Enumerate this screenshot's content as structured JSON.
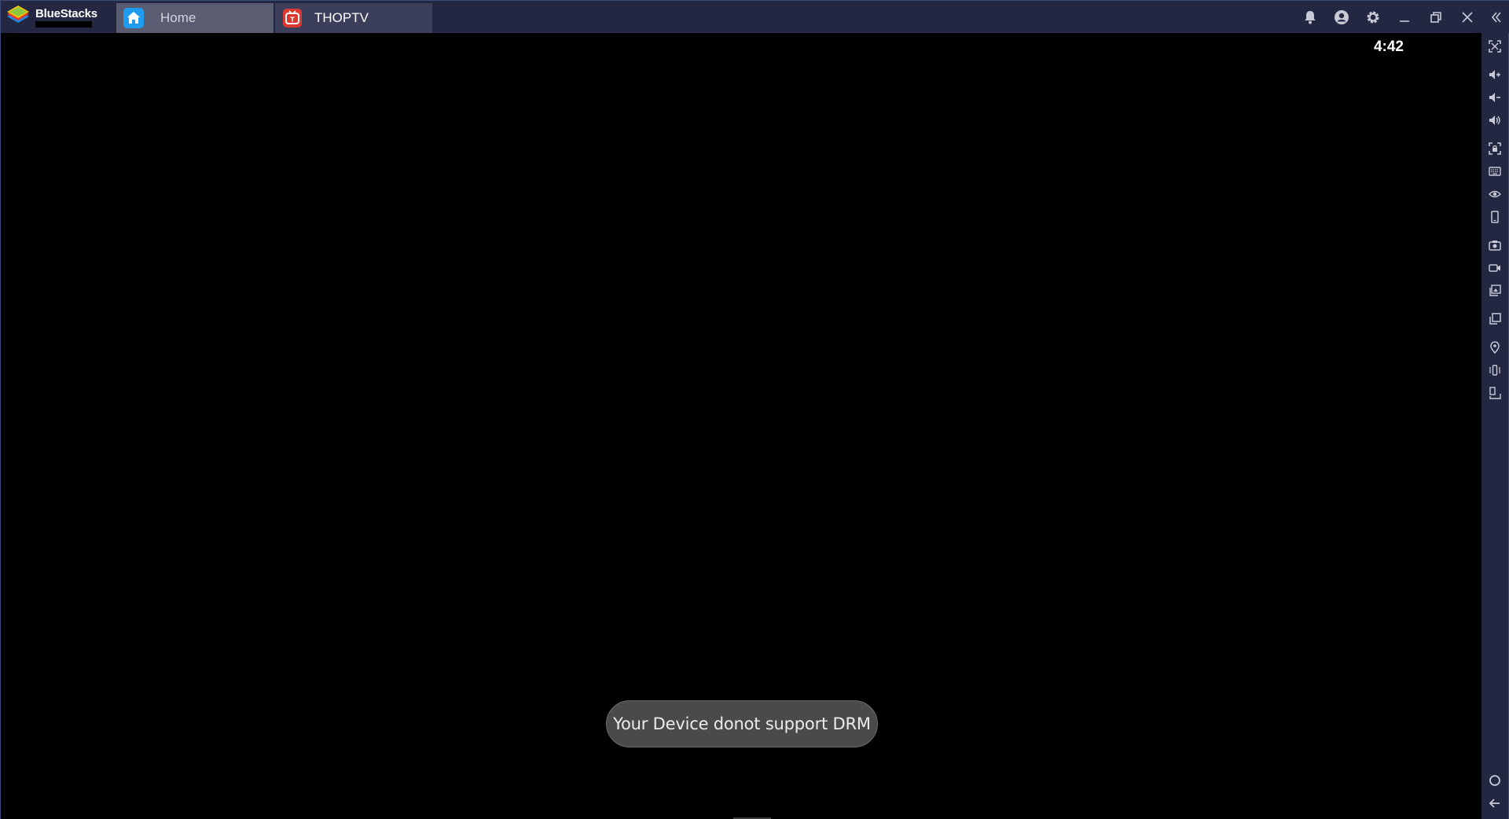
{
  "app": {
    "name": "BlueStacks",
    "brand_colors": {
      "green": "#8dc63f",
      "yellow": "#f7c600",
      "red": "#e03b2e",
      "blue": "#1e88e5"
    }
  },
  "tabs": [
    {
      "label": "Home",
      "icon": "home-icon",
      "active": false
    },
    {
      "label": "THOPTV",
      "icon": "thoptv-app-icon",
      "active": true
    }
  ],
  "window_controls": [
    "bell-icon",
    "account-icon",
    "gear-icon",
    "minimize-icon",
    "restore-icon",
    "close-icon",
    "collapse-sidebar-icon"
  ],
  "screen": {
    "clock": "4:42",
    "toast": "Your Device donot support DRM"
  },
  "sidebar": {
    "items": [
      "fullscreen-icon",
      "volume-up-icon",
      "volume-down-icon",
      "volume-icon",
      "screen-lock-icon",
      "keyboard-icon",
      "eye-icon",
      "phone-rotate-icon",
      "screenshot-icon",
      "video-record-icon",
      "media-folder-icon",
      "multi-instance-icon",
      "location-icon",
      "shake-icon",
      "resize-icon",
      "home-circle-icon",
      "back-arrow-icon"
    ]
  },
  "colors": {
    "titlebar": "#232742",
    "tab_active": "#3b3f5c",
    "tab_inactive": "#5a5c71",
    "toast_bg": "#4a4a4a"
  }
}
